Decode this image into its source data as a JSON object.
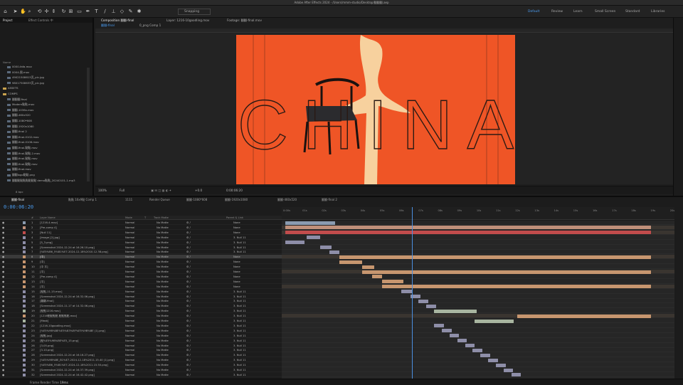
{
  "window_title": "Adobe After Effects 2024 - /Users/mmm-studio/Desktop/翻翻翻.aep",
  "toolbar": {
    "snapping_label": "Snapping",
    "workspaces": [
      "Default",
      "Review",
      "Learn",
      "Small Screen",
      "Standard",
      "Libraries"
    ],
    "active_workspace": "Default"
  },
  "project_panel": {
    "tabs": [
      "Project",
      "Effect Controls 中"
    ],
    "column_name": "Name",
    "files": [
      "0000-fafa.mov",
      "0004-围.mov",
      "49021508613页_pic.jpg",
      "98017508633页_pic.jpg",
      "ASSETS",
      "COMPS",
      "翻翻翻.final",
      "Modern點點.mov",
      "翻翻-1036x.mov",
      "翻翻-460x520",
      "翻翻-1080*608",
      "翻翻-1920x1080",
      "翻翻-final 2",
      "翻翻-final-0102.mov",
      "翻翻-final-0106.mov",
      "翻翻-final-點點.mov",
      "翻翻-final-點點-2.mov",
      "翻翻-final-點點.mov",
      "翻翻-final-點點.mov",
      "翻翻-final.mov",
      "翻翻logo點點.png",
      "翻翻點點點點點點點 demo點點_20240101-1.mp3"
    ],
    "footer_bpc": "8 bpc"
  },
  "composition": {
    "tabs": [
      "Composition 翻翻-final",
      "Layer: 1216-10goodling.mov",
      "Footage: 翻翻-final.mov"
    ],
    "breadcrumbs": [
      "翻翻-final",
      "0_png Comp 1"
    ],
    "artwork_text": "CHINA",
    "colors": {
      "background": "#ef5526",
      "brush": "#f7d8a4",
      "letters": "#2a1a14"
    },
    "footer": {
      "zoom": "100%",
      "resolution": "Full",
      "exposure": "+0.0",
      "time": "0:00:06:20"
    }
  },
  "timeline": {
    "tabs": [
      "翻翻-final",
      "點點 16x9點 Comp 1",
      "1111",
      "Render Queue",
      "翻翻-1080*608",
      "翻翻-1920x1080",
      "翻翻-460x520",
      "翻翻-final 2"
    ],
    "active_tab": "翻翻-final",
    "current_time": "0:00:06:20",
    "columns": [
      "#",
      "Layer Name",
      "Mode",
      "T",
      "Track Matte",
      "Parent & Link"
    ],
    "ruler_ticks": [
      "0:00s",
      "01s",
      "02s",
      "03s",
      "04s",
      "05s",
      "06s",
      "07s",
      "08s",
      "09s",
      "10s",
      "11s",
      "12s",
      "13s",
      "14s",
      "15s",
      "16s",
      "17s",
      "18s",
      "19s",
      "20s"
    ],
    "current_time_seconds": 6.67,
    "duration_seconds": 20,
    "layers": [
      {
        "n": "1",
        "name": "[1216-4.mov]",
        "mode": "Normal",
        "matte": "No Matte",
        "parent": "None",
        "start": 0.1,
        "end": 2.7,
        "color": "#8a9bb0"
      },
      {
        "n": "2",
        "name": "[Pre-comp 4]",
        "mode": "Normal",
        "matte": "No Matte",
        "parent": "None",
        "start": 0.1,
        "end": 19.0,
        "color": "#c0907a"
      },
      {
        "n": "3",
        "name": "[Null 11]",
        "mode": "Normal",
        "matte": "No Matte",
        "parent": "None",
        "start": 0.1,
        "end": 19.0,
        "color": "#c24c4c"
      },
      {
        "n": "4",
        "name": "[Image [2].jpg]",
        "mode": "Normal",
        "matte": "No Matte",
        "parent": "3. Null 11",
        "start": 1.2,
        "end": 1.9,
        "color": "#8e8ea8"
      },
      {
        "n": "5",
        "name": "[5_3.png]",
        "mode": "Normal",
        "matte": "No Matte",
        "parent": "3. Null 11",
        "start": 0.1,
        "end": 1.1,
        "color": "#8e8ea8"
      },
      {
        "n": "6",
        "name": "[Screenshot 2024-12-24 at 16.26.10.png]",
        "mode": "Normal",
        "matte": "No Matte",
        "parent": "3. Null 11",
        "start": 1.9,
        "end": 2.5,
        "color": "#8e8ea8"
      },
      {
        "n": "7",
        "name": "[%E5%B6_5%B1%E7-2024-12-18%2010.12.38.png]",
        "mode": "Normal",
        "matte": "No Matte",
        "parent": "3. Null 11",
        "start": 2.4,
        "end": 2.9,
        "color": "#8e8ea8"
      },
      {
        "n": "8",
        "name": "[中]",
        "mode": "Normal",
        "matte": "No Matte",
        "parent": "None",
        "start": 2.9,
        "end": 19.0,
        "color": "#c7966f"
      },
      {
        "n": "9",
        "name": "[中]",
        "mode": "Normal",
        "matte": "No Matte",
        "parent": "None",
        "start": 2.9,
        "end": 4.1,
        "color": "#c7966f"
      },
      {
        "n": "10",
        "name": "[中 平]",
        "mode": "Normal",
        "matte": "No Matte",
        "parent": "None",
        "start": 4.1,
        "end": 4.7,
        "color": "#c7966f"
      },
      {
        "n": "11",
        "name": "[平]",
        "mode": "Normal",
        "matte": "No Matte",
        "parent": "None",
        "start": 4.1,
        "end": 19.0,
        "color": "#c7966f"
      },
      {
        "n": "12",
        "name": "[Pre-comp 4]",
        "mode": "Normal",
        "matte": "No Matte",
        "parent": "None",
        "start": 4.6,
        "end": 5.1,
        "color": "#c7966f"
      },
      {
        "n": "13",
        "name": "[平]",
        "mode": "Normal",
        "matte": "No Matte",
        "parent": "None",
        "start": 5.1,
        "end": 6.2,
        "color": "#c7966f"
      },
      {
        "n": "14",
        "name": "[平]",
        "mode": "Normal",
        "matte": "No Matte",
        "parent": "None",
        "start": 5.1,
        "end": 19.0,
        "color": "#c7966f"
      },
      {
        "n": "15",
        "name": "[點點-11-15.mov]",
        "mode": "Normal",
        "matte": "No Matte",
        "parent": "3. Null 11",
        "start": 6.1,
        "end": 6.7,
        "color": "#8e8ea8"
      },
      {
        "n": "16",
        "name": "[Screenshot 2024-12-24 at 16.32.06.png]",
        "mode": "Normal",
        "matte": "No Matte",
        "parent": "3. Null 11",
        "start": 6.6,
        "end": 7.1,
        "color": "#8e8ea8"
      },
      {
        "n": "17",
        "name": "[翻翻-final]",
        "mode": "Normal",
        "matte": "No Matte",
        "parent": "3. Null 11",
        "start": 7.0,
        "end": 7.5,
        "color": "#8e8ea8"
      },
      {
        "n": "18",
        "name": "[Screenshot 2024-11-17 at 14.32.06.png]",
        "mode": "Normal",
        "matte": "No Matte",
        "parent": "3. Null 11",
        "start": 7.4,
        "end": 7.9,
        "color": "#8e8ea8"
      },
      {
        "n": "19",
        "name": "[點點1216.mov]",
        "mode": "Normal",
        "matte": "No Matte",
        "parent": "3. Null 11",
        "start": 7.8,
        "end": 10.0,
        "color": "#a8b5a0"
      },
      {
        "n": "20",
        "name": "[1216點點點點 點點點點.mov]",
        "mode": "Normal",
        "matte": "No Matte",
        "parent": "3. Null 11",
        "start": 12.1,
        "end": 19.0,
        "color": "#c7966f"
      },
      {
        "n": "21",
        "name": "[Mask]",
        "mode": "Normal",
        "matte": "No Matte",
        "parent": "3. Null 11",
        "start": 9.9,
        "end": 11.9,
        "color": "#a8b5a0"
      },
      {
        "n": "22",
        "name": "[1216-10goodling.mov]",
        "mode": "Normal",
        "matte": "No Matte",
        "parent": "3. Null 11",
        "start": 7.8,
        "end": 8.3,
        "color": "#8e8ea8"
      },
      {
        "n": "23",
        "name": "[%E5%9B%BE%E5%83%8F%E5%9B%BE (1).png]",
        "mode": "Normal",
        "matte": "No Matte",
        "parent": "3. Null 11",
        "start": 8.2,
        "end": 8.7,
        "color": "#8e8ea8"
      },
      {
        "n": "24",
        "name": "[點點.jpg]",
        "mode": "Normal",
        "matte": "No Matte",
        "parent": "3. Null 11",
        "start": 8.6,
        "end": 9.1,
        "color": "#8e8ea8"
      },
      {
        "n": "25",
        "name": "[點%E5%9B%BE%E5_15.png]",
        "mode": "Normal",
        "matte": "No Matte",
        "parent": "3. Null 11",
        "start": 9.0,
        "end": 9.5,
        "color": "#8e8ea8"
      },
      {
        "n": "26",
        "name": "[3-05.png]",
        "mode": "Normal",
        "matte": "No Matte",
        "parent": "3. Null 11",
        "start": 9.4,
        "end": 9.9,
        "color": "#8e8ea8"
      },
      {
        "n": "27",
        "name": "[3-10.png]",
        "mode": "Normal",
        "matte": "No Matte",
        "parent": "3. Null 11",
        "start": 9.8,
        "end": 10.3,
        "color": "#8e8ea8"
      },
      {
        "n": "28",
        "name": "[Screenshot 2024-12-24 at 16.16.27.png]",
        "mode": "Normal",
        "matte": "No Matte",
        "parent": "3. Null 11",
        "start": 10.2,
        "end": 10.7,
        "color": "#8e8ea8"
      },
      {
        "n": "29",
        "name": "[%E5%9B%BE_B1%E7-2024-12-18%2011.15.40 (1).png]",
        "mode": "Normal",
        "matte": "No Matte",
        "parent": "3. Null 11",
        "start": 10.6,
        "end": 11.1,
        "color": "#8e8ea8"
      },
      {
        "n": "30",
        "name": "[%E5%B6_5%B1%E7-2024-12-18%2011.15.50.png]",
        "mode": "Normal",
        "matte": "No Matte",
        "parent": "3. Null 11",
        "start": 11.0,
        "end": 11.5,
        "color": "#8e8ea8"
      },
      {
        "n": "31",
        "name": "[Screenshot 2024-12-24 at 16.37.39.png]",
        "mode": "Normal",
        "matte": "No Matte",
        "parent": "3. Null 11",
        "start": 11.4,
        "end": 11.9,
        "color": "#8e8ea8"
      },
      {
        "n": "32",
        "name": "[Screenshot 2024-12-24 at 16.42.42.png]",
        "mode": "Normal",
        "matte": "No Matte",
        "parent": "3. Null 11",
        "start": 11.8,
        "end": 12.3,
        "color": "#8e8ea8"
      }
    ],
    "footer_label": "Frame Render Time",
    "footer_value": "19ms"
  }
}
